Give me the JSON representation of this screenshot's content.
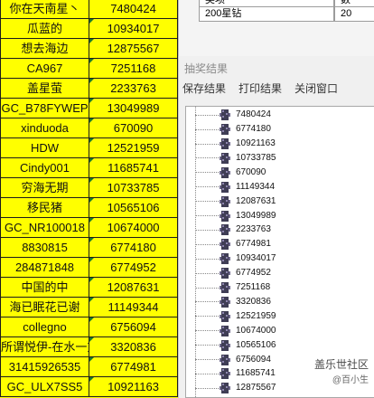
{
  "spreadsheet": {
    "rows": [
      {
        "name": "你在天南星丶",
        "id": "7480424",
        "flag": false
      },
      {
        "name": "瓜蓝的",
        "id": "10934017",
        "flag": true
      },
      {
        "name": "想去海边",
        "id": "12875567",
        "flag": true
      },
      {
        "name": "CA967",
        "id": "7251168",
        "flag": true
      },
      {
        "name": "盖星萤",
        "id": "2233763",
        "flag": true
      },
      {
        "name": "GC_B78FYWEP",
        "id": "13049989",
        "flag": true
      },
      {
        "name": "xinduoda",
        "id": "670090",
        "flag": true
      },
      {
        "name": "HDW",
        "id": "12521959",
        "flag": true
      },
      {
        "name": "Cindy001",
        "id": "11685741",
        "flag": true
      },
      {
        "name": "穷海无期",
        "id": "10733785",
        "flag": true
      },
      {
        "name": "移民猪",
        "id": "10565106",
        "flag": true
      },
      {
        "name": "GC_NR100018",
        "id": "10674000",
        "flag": true
      },
      {
        "name": "8830815",
        "id": "6774180",
        "flag": true
      },
      {
        "name": "284871848",
        "id": "6774952",
        "flag": true
      },
      {
        "name": "中国的中",
        "id": "12087631",
        "flag": true
      },
      {
        "name": "海已眠花已谢",
        "id": "11149344",
        "flag": true
      },
      {
        "name": "collegno",
        "id": "6756094",
        "flag": true
      },
      {
        "name": "所谓悦伊-在水一方",
        "id": "3320836",
        "flag": true
      },
      {
        "name": "31415926535",
        "id": "6774981",
        "flag": true
      },
      {
        "name": "GC_ULX7SS5",
        "id": "10921163",
        "flag": true
      }
    ]
  },
  "bg_table": {
    "header_left": "奖项",
    "header_right": "数",
    "row_label": "200星钻",
    "row_count": "20"
  },
  "dialog": {
    "title": "抽奖结果",
    "menu": {
      "save": "保存结果",
      "print": "打印结果",
      "close": "关闭窗口"
    },
    "results": [
      "7480424",
      "6774180",
      "10921163",
      "10733785",
      "670090",
      "11149344",
      "12087631",
      "13049989",
      "2233763",
      "6774981",
      "10934017",
      "6774952",
      "7251168",
      "3320836",
      "12521959",
      "10674000",
      "10565106",
      "6756094",
      "11685741",
      "12875567"
    ]
  },
  "watermark": {
    "main": "盖乐世社区",
    "sub": "@百小生"
  },
  "colors": {
    "sheet_fill": "#ffff00",
    "cell_flag": "#1a7a2a",
    "dialog_bg": "#f0f0f0"
  }
}
